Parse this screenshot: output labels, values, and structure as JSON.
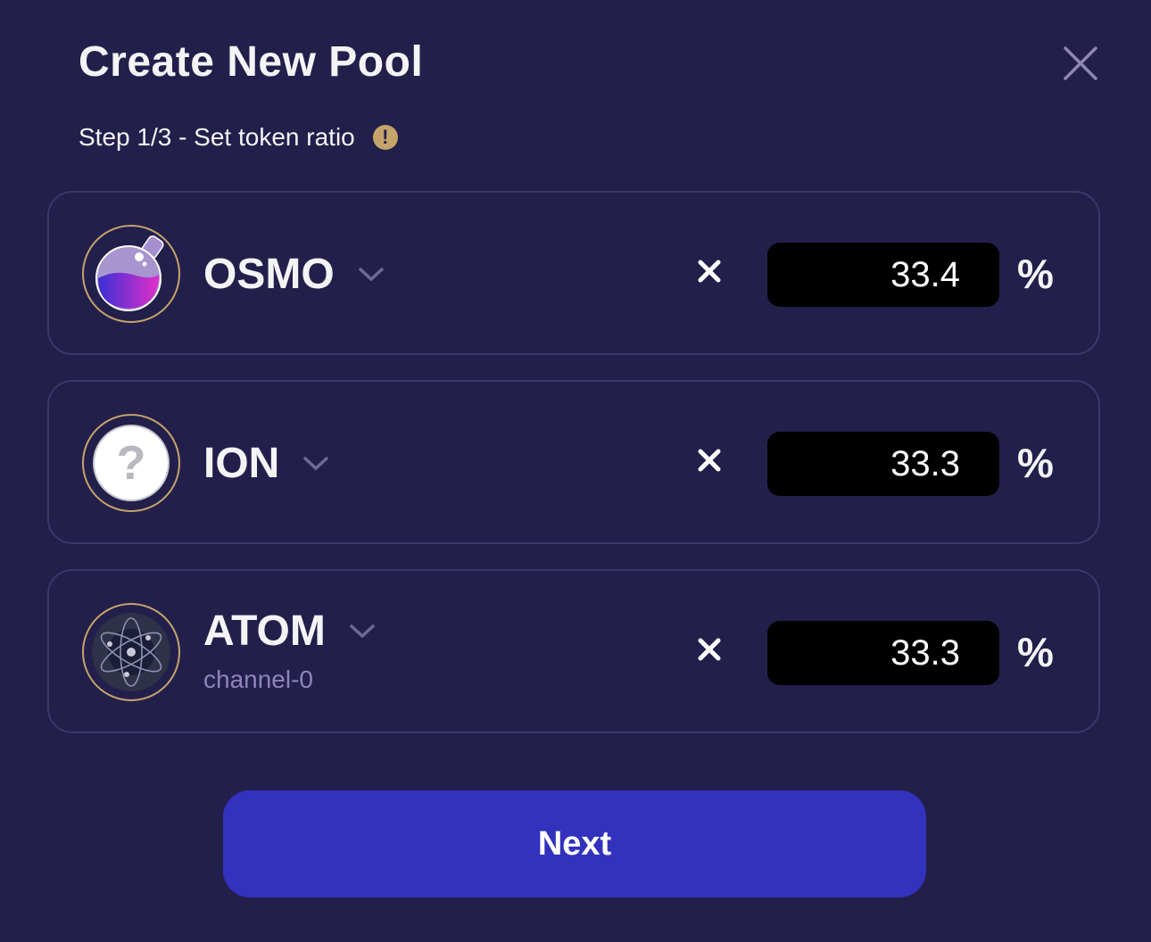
{
  "header": {
    "title": "Create New Pool",
    "step": "Step 1/3 - Set token ratio",
    "warning_glyph": "!"
  },
  "tokens": [
    {
      "symbol": "OSMO",
      "channel": null,
      "ratio": "33.4",
      "unit": "%",
      "icon": "osmo-flask-icon"
    },
    {
      "symbol": "ION",
      "channel": null,
      "ratio": "33.3",
      "unit": "%",
      "icon": "question-icon"
    },
    {
      "symbol": "ATOM",
      "channel": "channel-0",
      "ratio": "33.3",
      "unit": "%",
      "icon": "cosmos-atom-icon"
    }
  ],
  "next_label": "Next",
  "colors": {
    "background": "#231f4b",
    "accent": "#3232be",
    "gold": "#c4a46a",
    "input_bg": "#000000"
  }
}
